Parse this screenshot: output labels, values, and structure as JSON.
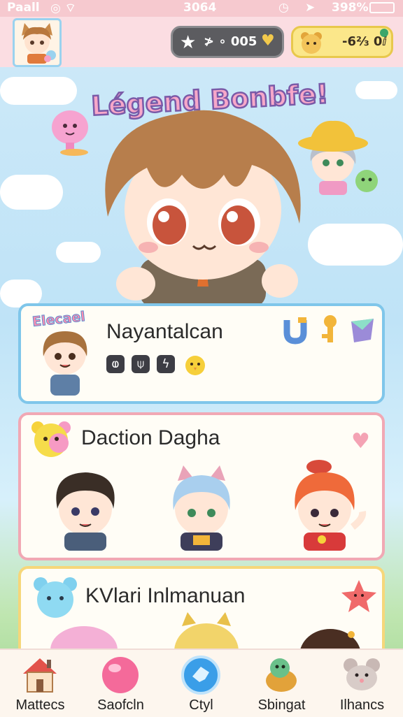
{
  "status_bar": {
    "carrier": "Paall",
    "time": "3064",
    "battery": "398%"
  },
  "header": {
    "stars_value": "≯ ∘ 005",
    "coins_value": "-6⅔ 0ⅈ"
  },
  "game_title": "Légend Bonbfe!",
  "cards": [
    {
      "ribbon": "Elecael",
      "title": "Nayantalcan",
      "abilities": [
        "ⱷ",
        "⍦",
        "ϟ"
      ]
    },
    {
      "title": "Daction Dagha"
    },
    {
      "title": "KVlari Inlmanuan"
    }
  ],
  "nav": [
    {
      "label": "Mattecs",
      "icon": "house-icon"
    },
    {
      "label": "Saofcln",
      "icon": "pink-orb-icon"
    },
    {
      "label": "Ctyl",
      "icon": "blue-orb-icon"
    },
    {
      "label": "Sbingat",
      "icon": "turtle-icon"
    },
    {
      "label": "Ilhancs",
      "icon": "mouse-icon"
    }
  ],
  "colors": {
    "status_bar": "#f6c9cf",
    "card_blue_border": "#7fc6ea",
    "card_pink_border": "#f1a8b4",
    "card_yellow_border": "#f6d77a"
  }
}
